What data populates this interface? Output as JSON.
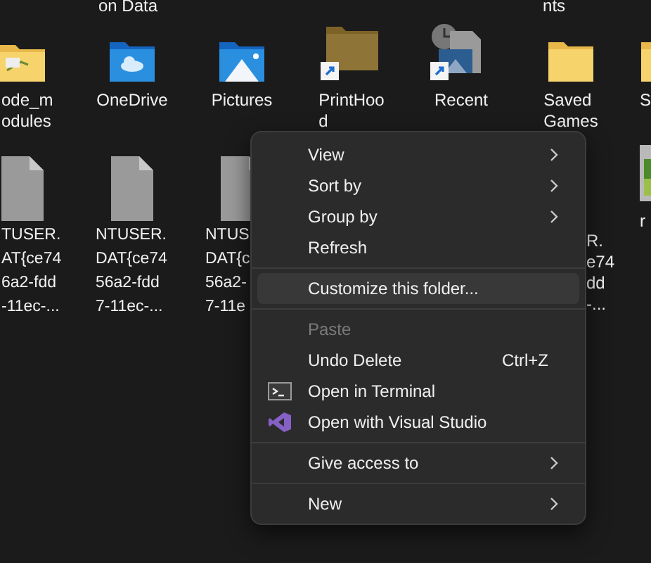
{
  "top_strip": {
    "left_label": "on Data",
    "right_label": "nts"
  },
  "folders": [
    {
      "kind": "project-folder",
      "lines": [
        "ode_m",
        "odules"
      ]
    },
    {
      "kind": "onedrive-folder",
      "lines": [
        "OneDrive"
      ]
    },
    {
      "kind": "pictures-folder",
      "lines": [
        "Pictures"
      ]
    },
    {
      "kind": "shortcut-folder",
      "lines": [
        "PrintHoo",
        "d"
      ]
    },
    {
      "kind": "recent-shortcut",
      "lines": [
        "Recent"
      ]
    },
    {
      "kind": "folder",
      "lines": [
        "Saved",
        "Games"
      ]
    },
    {
      "kind": "folder",
      "lines": [
        "S"
      ]
    }
  ],
  "files_left_of_menu": [
    {
      "kind": "file",
      "lines": [
        "TUSER.",
        "AT{ce74",
        "6a2-fdd",
        "-11ec-..."
      ]
    },
    {
      "kind": "file",
      "lines": [
        "NTUSER.",
        "DAT{ce74",
        "56a2-fdd",
        "7-11ec-..."
      ]
    },
    {
      "kind": "file",
      "lines": [
        "NTUS",
        "DAT{c",
        "56a2-",
        "7-11e"
      ]
    }
  ],
  "files_right_of_menu": [
    {
      "kind": "text-only",
      "lines": [
        "R.",
        "e74",
        "dd",
        "-..."
      ]
    },
    {
      "kind": "image-file",
      "lines": [
        "r"
      ]
    }
  ],
  "context_menu": [
    {
      "kind": "item",
      "label": "View",
      "submenu": true,
      "disabled": false,
      "selected": false
    },
    {
      "kind": "item",
      "label": "Sort by",
      "submenu": true,
      "disabled": false,
      "selected": false
    },
    {
      "kind": "item",
      "label": "Group by",
      "submenu": true,
      "disabled": false,
      "selected": false
    },
    {
      "kind": "item",
      "label": "Refresh",
      "submenu": false,
      "disabled": false,
      "selected": false
    },
    {
      "kind": "separator"
    },
    {
      "kind": "item",
      "label": "Customize this folder...",
      "submenu": false,
      "disabled": false,
      "selected": true
    },
    {
      "kind": "separator"
    },
    {
      "kind": "item",
      "label": "Paste",
      "submenu": false,
      "disabled": true,
      "selected": false
    },
    {
      "kind": "item",
      "label": "Undo Delete",
      "shortcut": "Ctrl+Z",
      "submenu": false,
      "disabled": false,
      "selected": false
    },
    {
      "kind": "terminal-item",
      "label": "Open in Terminal",
      "submenu": false,
      "disabled": false,
      "selected": false
    },
    {
      "kind": "visual-studio-item",
      "label": "Open with Visual Studio",
      "submenu": false,
      "disabled": false,
      "selected": false
    },
    {
      "kind": "separator"
    },
    {
      "kind": "item",
      "label": "Give access to",
      "submenu": true,
      "disabled": false,
      "selected": false
    },
    {
      "kind": "separator"
    },
    {
      "kind": "item",
      "label": "New",
      "submenu": true,
      "disabled": false,
      "selected": false
    }
  ]
}
